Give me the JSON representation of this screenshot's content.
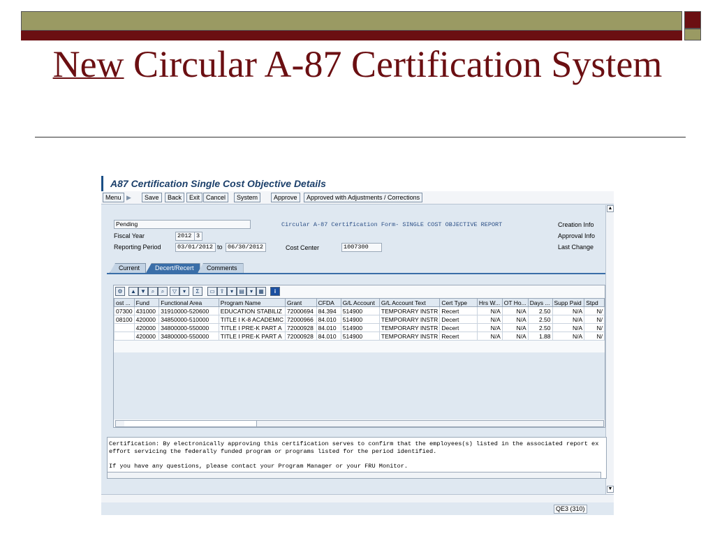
{
  "slide": {
    "title_underlined": "New",
    "title_rest": " Circular A-87 Certification System"
  },
  "window": {
    "title": "A87 Certification Single Cost Objective Details"
  },
  "toolbar": {
    "menu": "Menu",
    "save": "Save",
    "back": "Back",
    "exit": "Exit",
    "cancel": "Cancel",
    "system": "System",
    "approve": "Approve",
    "approve_adj": "Approved with Adjustments / Corrections"
  },
  "header": {
    "status": "Pending",
    "fiscal_year_label": "Fiscal Year",
    "fiscal_year": "2012",
    "fiscal_period": "3",
    "reporting_period_label": "Reporting Period",
    "period_from": "03/01/2012",
    "to_label": "to",
    "period_to": "06/30/2012",
    "form_title": "Circular A-87 Certification Form- SINGLE COST OBJECTIVE REPORT",
    "cost_center_label": "Cost Center",
    "cost_center": "1007300",
    "creation_info": "Creation Info",
    "approval_info": "Approval Info",
    "last_change": "Last Change"
  },
  "tabs": [
    "Current",
    "Decert/Recert",
    "Comments"
  ],
  "grid": {
    "columns": [
      "ost ...",
      "Fund",
      "Functional Area",
      "Program Name",
      "Grant",
      "CFDA",
      "G/L Account",
      "G/L Account Text",
      "Cert Type",
      "Hrs W...",
      "OT Ho...",
      "Days ...",
      "Supp Paid",
      "Stpd"
    ],
    "rows": [
      [
        "07300",
        "431000",
        "31910000-520600",
        "EDUCATION STABILIZ",
        "72000694",
        "84.394",
        "514900",
        "TEMPORARY INSTR",
        "Recert",
        "N/A",
        "N/A",
        "2.50",
        "N/A",
        "N/"
      ],
      [
        "08100",
        "420000",
        "34850000-510000",
        "TITLE I K-8 ACADEMIC",
        "72000966",
        "84.010",
        "514900",
        "TEMPORARY INSTR",
        "Decert",
        "N/A",
        "N/A",
        "2.50",
        "N/A",
        "N/"
      ],
      [
        "",
        "420000",
        "34800000-550000",
        "TITLE I PRE-K  PART A",
        "72000928",
        "84.010",
        "514900",
        "TEMPORARY INSTR",
        "Decert",
        "N/A",
        "N/A",
        "2.50",
        "N/A",
        "N/"
      ],
      [
        "",
        "420000",
        "34800000-550000",
        "TITLE I PRE-K  PART A",
        "72000928",
        "84.010",
        "514900",
        "TEMPORARY INSTR",
        "Recert",
        "N/A",
        "N/A",
        "1.88",
        "N/A",
        "N/"
      ]
    ]
  },
  "certification_text": {
    "line1": "Certification: By electronically approving this certification serves to confirm that the employees(s) listed in the associated report ex",
    "line2": "effort servicing the federally funded program or programs listed for the period identified.",
    "line3": "If you have any questions, please contact your Program Manager or your FRU Monitor."
  },
  "status_bar": {
    "system": "QE3 (310)"
  },
  "colors": {
    "title": "#6b0f12",
    "header_olive": "#9a9a63",
    "sap_background": "#dfe8f1",
    "sap_accent": "#3a6ea8"
  }
}
